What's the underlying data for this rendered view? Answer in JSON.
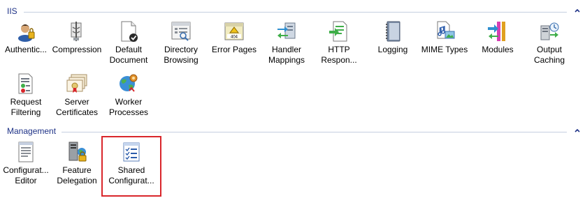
{
  "groups": [
    {
      "title": "IIS",
      "features": [
        {
          "label": "Authentic...",
          "icon": "authentication-icon"
        },
        {
          "label": "Compression",
          "icon": "compression-icon"
        },
        {
          "label": "Default\nDocument",
          "icon": "default-document-icon"
        },
        {
          "label": "Directory\nBrowsing",
          "icon": "directory-browsing-icon"
        },
        {
          "label": "Error Pages",
          "icon": "error-pages-icon"
        },
        {
          "label": "Handler\nMappings",
          "icon": "handler-mappings-icon"
        },
        {
          "label": "HTTP\nRespon...",
          "icon": "http-response-headers-icon"
        },
        {
          "label": "Logging",
          "icon": "logging-icon"
        },
        {
          "label": "MIME Types",
          "icon": "mime-types-icon"
        },
        {
          "label": "Modules",
          "icon": "modules-icon"
        },
        {
          "label": "Output\nCaching",
          "icon": "output-caching-icon"
        },
        {
          "label": "Request\nFiltering",
          "icon": "request-filtering-icon"
        },
        {
          "label": "Server\nCertificates",
          "icon": "server-certificates-icon"
        },
        {
          "label": "Worker\nProcesses",
          "icon": "worker-processes-icon"
        }
      ]
    },
    {
      "title": "Management",
      "features": [
        {
          "label": "Configurat...\nEditor",
          "icon": "configuration-editor-icon"
        },
        {
          "label": "Feature\nDelegation",
          "icon": "feature-delegation-icon"
        },
        {
          "label": "Shared\nConfigurat...",
          "icon": "shared-configuration-icon",
          "selected": true
        }
      ]
    }
  ],
  "error_pages_icon_text": "404",
  "colors": {
    "group_title": "#1e3287",
    "selection_border": "#d9262b",
    "divider": "#c5cfe0"
  }
}
